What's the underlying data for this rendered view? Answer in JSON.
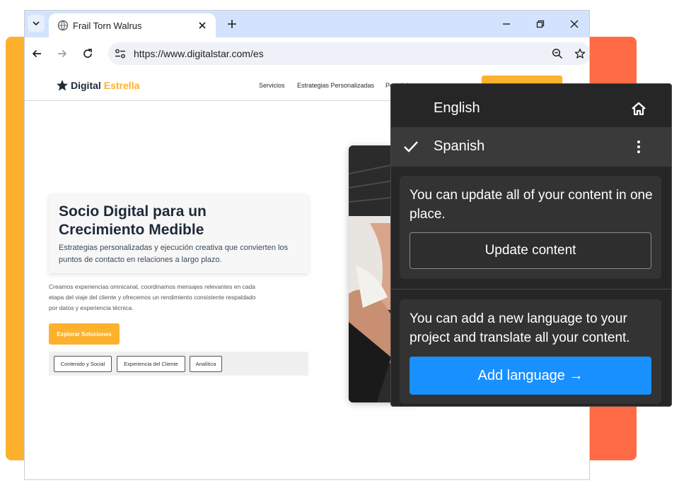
{
  "browser": {
    "tab_title": "Frail Torn Walrus",
    "url": "https://www.digitalstar.com/es"
  },
  "site": {
    "logo_primary": "Digital",
    "logo_secondary": "Estrella",
    "nav": [
      "Servicios",
      "Estrategias Personalizadas",
      "Portafolio"
    ],
    "hero_title": "Socio Digital para un Crecimiento Medible",
    "hero_subtitle": "Estrategias personalizadas y ejecución creativa que convierten los puntos de contacto en relaciones a largo plazo.",
    "body": "Creamos experiencias omnicanal, coordinamos mensajes relevantes en cada etapa del viaje del cliente y ofrecemos un rendimiento consistente respaldado por datos y experiencia técnica.",
    "cta": "Explorar Soluciones",
    "chips": [
      "Contenido y Social",
      "Experiencia del Cliente",
      "Analítica"
    ]
  },
  "panel": {
    "languages": [
      {
        "label": "English",
        "selected": false
      },
      {
        "label": "Spanish",
        "selected": true
      }
    ],
    "update_text": "You can update all of your content in one place.",
    "update_button": "Update content",
    "add_text": "You can add a new language to your project and translate all your content.",
    "add_button": "Add language →"
  },
  "colors": {
    "accent_yellow": "#FDB12D",
    "accent_orange": "#FF6B45",
    "panel_bg": "#262626",
    "primary_blue": "#1890ff"
  }
}
